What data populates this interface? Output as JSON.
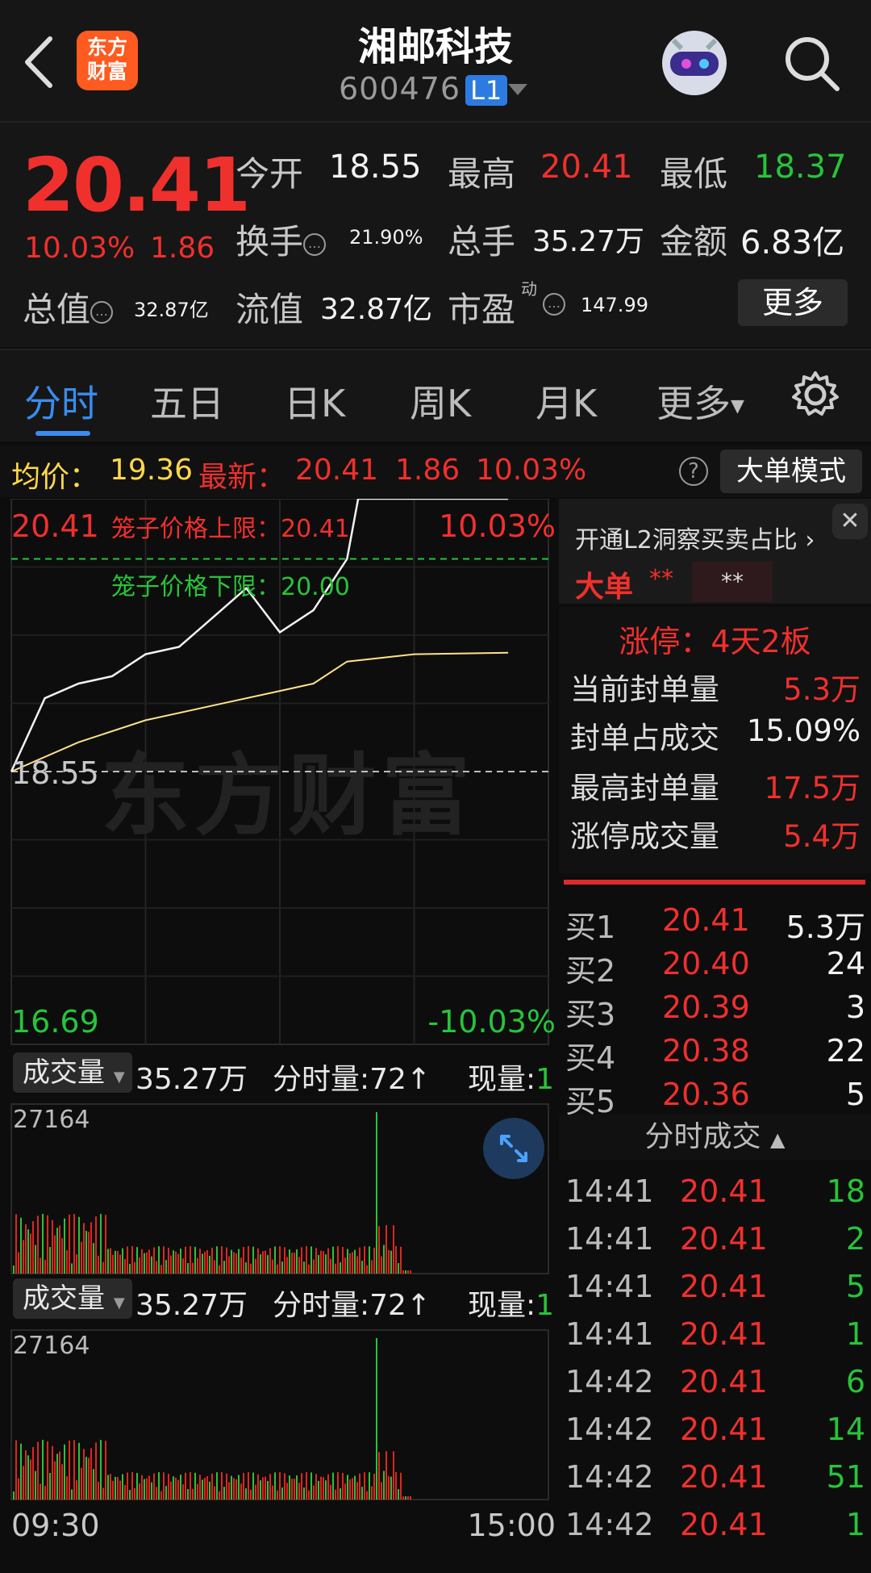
{
  "header": {
    "title": "湘邮科技",
    "code": "600476",
    "level": "L1",
    "logo_text": "东方财富"
  },
  "quote": {
    "price": "20.41",
    "pct": "10.03%",
    "chg": "1.86",
    "open_label": "今开",
    "open": "18.55",
    "high_label": "最高",
    "high": "20.41",
    "low_label": "最低",
    "low": "18.37",
    "turnover_label": "换手",
    "turnover": "21.90%",
    "volume_label": "总手",
    "volume": "35.27万",
    "amount_label": "金额",
    "amount": "6.83亿",
    "mktcap_label": "总值",
    "mktcap": "32.87亿",
    "float_label": "流值",
    "float": "32.87亿",
    "pe_label": "市盈",
    "pe_sup": "动",
    "pe": "147.99",
    "more_label": "更多"
  },
  "tabs": [
    "分时",
    "五日",
    "日K",
    "周K",
    "月K",
    "更多"
  ],
  "avg_bar": {
    "avg_label": "均价：",
    "avg": "19.36",
    "latest_label": "最新：",
    "latest": "20.41",
    "chg": "1.86",
    "pct": "10.03%",
    "mode_label": "大单模式"
  },
  "chart": {
    "top_price": "20.41",
    "top_pct": "10.03%",
    "bottom_price": "16.69",
    "bottom_pct": "-10.03%",
    "ref_price": "18.55",
    "upper_limit": "笼子价格上限：20.41",
    "lower_limit": "笼子价格下限：20.00",
    "watermark": "东方财富",
    "vol_label": "成交量",
    "vol_total": "35.27万",
    "vol_min": "分时量:72↑",
    "vol_now_label": "现量:",
    "vol_now": "1",
    "vol_max": "27164",
    "time_start": "09:30",
    "time_end": "15:00"
  },
  "chart_data": {
    "type": "line",
    "series": [
      {
        "x": [
          "09:30",
          "09:45",
          "10:00",
          "10:15",
          "10:30",
          "10:45",
          "11:00",
          "11:15",
          "11:30",
          "13:15",
          "13:30",
          "13:35",
          "13:40",
          "14:00",
          "14:30",
          "14:42"
        ],
        "values": [
          18.55,
          19.05,
          19.15,
          19.2,
          19.35,
          19.4,
          19.6,
          19.8,
          19.5,
          19.65,
          20.0,
          20.41,
          20.41,
          20.41,
          20.41,
          20.41
        ]
      },
      {
        "x": [
          "09:30",
          "10:00",
          "10:30",
          "11:00",
          "11:30",
          "13:15",
          "13:30",
          "14:00",
          "14:42"
        ],
        "values": [
          18.55,
          18.75,
          18.9,
          19.0,
          19.1,
          19.15,
          19.3,
          19.35,
          19.36
        ]
      }
    ],
    "ylim": [
      16.69,
      20.41
    ]
  },
  "panel": {
    "l2_text": "开通L2洞察买卖占比",
    "big_order": "大单",
    "star1": "**",
    "star2": "**",
    "zt_title": "涨停：4天2板",
    "rows": [
      {
        "label": "当前封单量",
        "value": "5.3万"
      },
      {
        "label": "封单占成交",
        "value": "15.09%"
      },
      {
        "label": "最高封单量",
        "value": "17.5万"
      },
      {
        "label": "涨停成交量",
        "value": "5.4万"
      }
    ],
    "bids": [
      {
        "n": "买1",
        "p": "20.41",
        "q": "5.3万"
      },
      {
        "n": "买2",
        "p": "20.40",
        "q": "24"
      },
      {
        "n": "买3",
        "p": "20.39",
        "q": "3"
      },
      {
        "n": "买4",
        "p": "20.38",
        "q": "22"
      },
      {
        "n": "买5",
        "p": "20.36",
        "q": "5"
      }
    ],
    "ticks_label": "分时成交",
    "ticks": [
      {
        "t": "14:41",
        "p": "20.41",
        "q": "18"
      },
      {
        "t": "14:41",
        "p": "20.41",
        "q": "2"
      },
      {
        "t": "14:41",
        "p": "20.41",
        "q": "5"
      },
      {
        "t": "14:41",
        "p": "20.41",
        "q": "1"
      },
      {
        "t": "14:42",
        "p": "20.41",
        "q": "6"
      },
      {
        "t": "14:42",
        "p": "20.41",
        "q": "14"
      },
      {
        "t": "14:42",
        "p": "20.41",
        "q": "51"
      },
      {
        "t": "14:42",
        "p": "20.41",
        "q": "1"
      }
    ]
  },
  "colors": {
    "up": "#f0302d",
    "down": "#27c43a",
    "avg": "#ffd84a",
    "accent": "#3a8cf0"
  }
}
